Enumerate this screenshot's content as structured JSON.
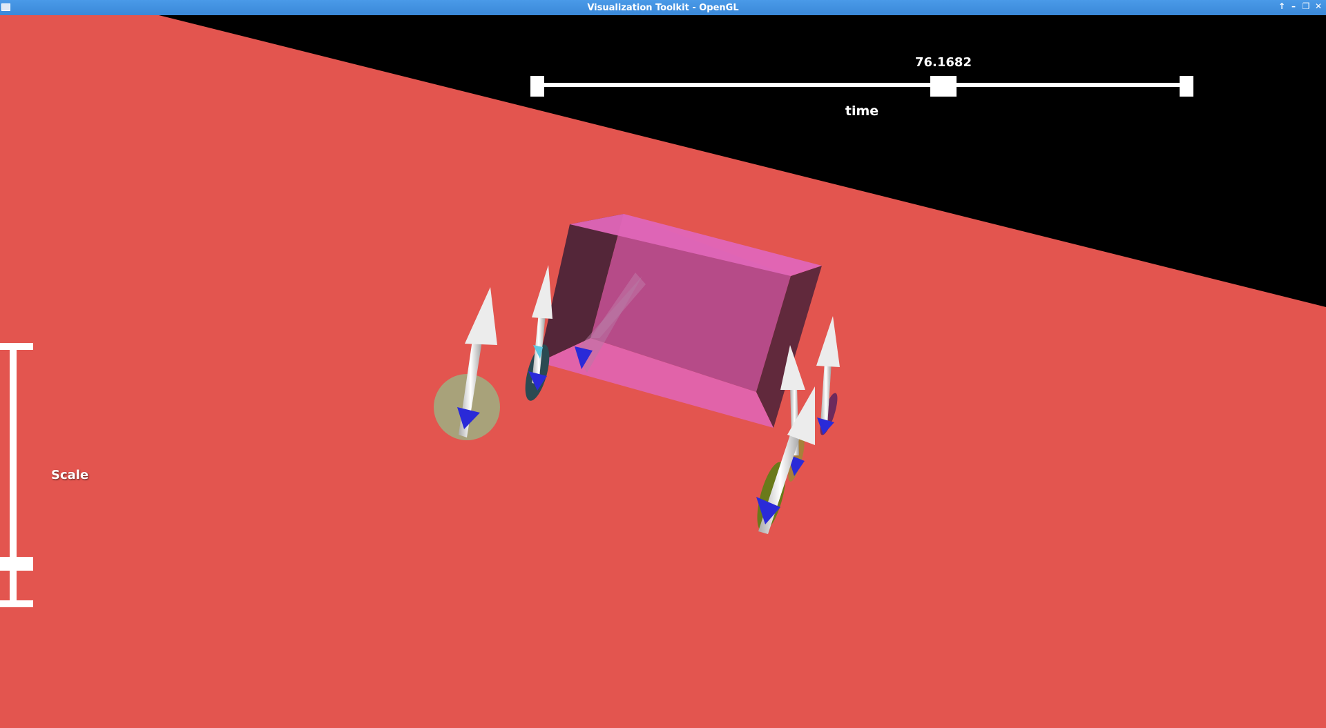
{
  "window": {
    "title": "Visualization Toolkit - OpenGL",
    "controls": [
      "↑",
      "–",
      "❐",
      "✕"
    ]
  },
  "slider": {
    "value_label": "76.1682",
    "title": "time",
    "fraction": 0.626
  },
  "scale_label": "Scale",
  "colors": {
    "ground": "#e3554f",
    "background": "#000000",
    "box": "#e066b8",
    "widget": "#ffffff"
  }
}
